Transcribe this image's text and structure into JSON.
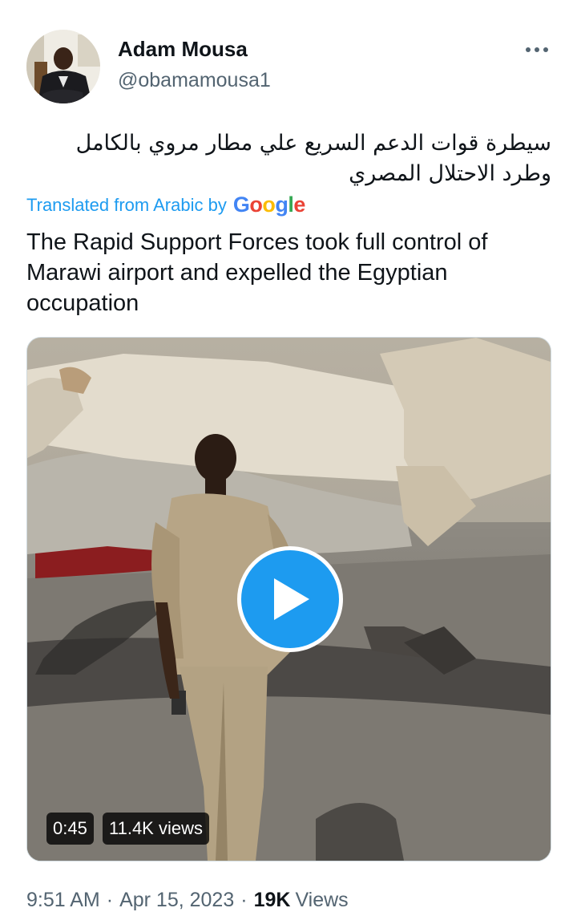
{
  "tweet": {
    "author": {
      "display_name": "Adam Mousa",
      "handle": "@obamamousa1",
      "avatar_icon": "user-avatar"
    },
    "more_icon": "more-horizontal-icon",
    "text_original": "سيطرة قوات الدعم السريع علي مطار مروي بالكامل وطرد الاحتلال المصري",
    "translation": {
      "label": "Translated from Arabic by",
      "provider": "Google",
      "provider_colors": [
        "#4285F4",
        "#EA4335",
        "#FBBC05",
        "#4285F4",
        "#34A853",
        "#EA4335"
      ]
    },
    "text_translated": "The Rapid Support Forces took full control of Marawi airport and expelled the Egyptian occupation",
    "media": {
      "type": "video",
      "play_icon": "play-icon",
      "duration": "0:45",
      "views": "11.4K views"
    },
    "meta": {
      "time": "9:51 AM",
      "date": "Apr 15, 2023",
      "separator": "·",
      "view_count": "19K",
      "view_label": "Views"
    },
    "colors": {
      "accent": "#1d9bf0",
      "text": "#0f1419",
      "secondary": "#536471"
    }
  }
}
